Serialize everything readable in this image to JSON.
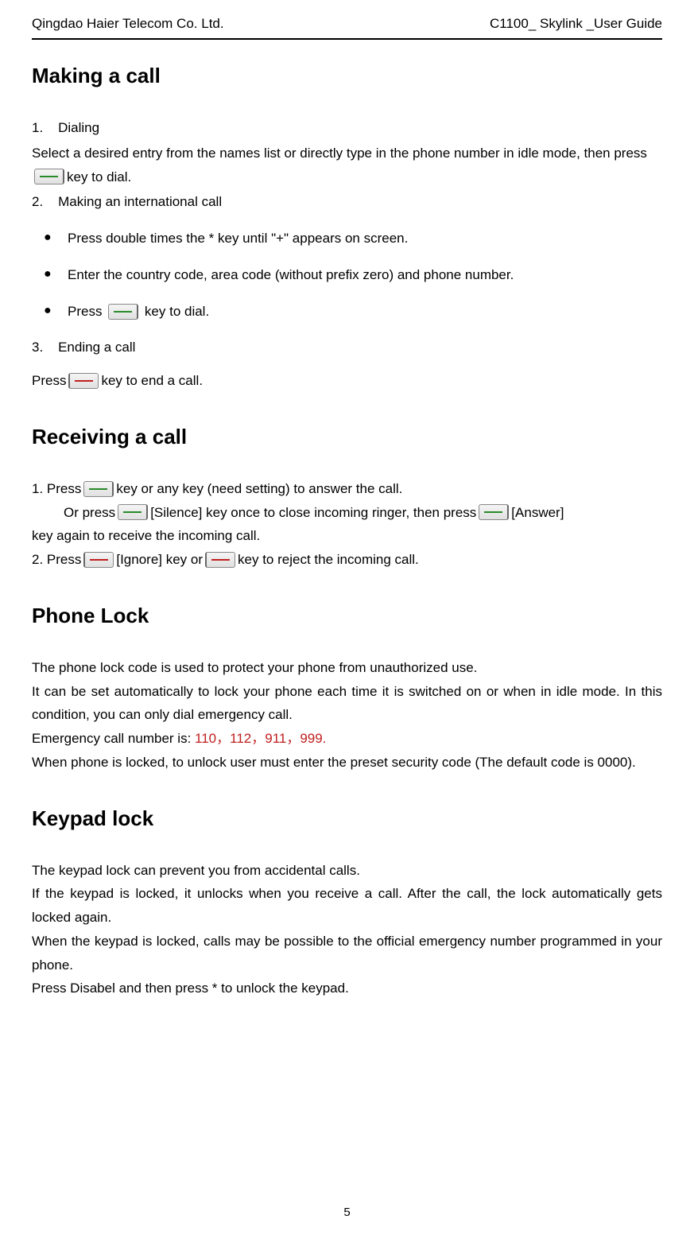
{
  "header": {
    "left": "Qingdao Haier Telecom Co. Ltd.",
    "right": "C1100_ Skylink _User Guide"
  },
  "sections": {
    "making_call": {
      "title": "Making a call",
      "item1_num": "1.",
      "item1_label": "Dialing",
      "item1_text_a": "Select a desired entry from the names list or directly type in the phone number in idle mode, then press ",
      "item1_text_b": " key to dial.",
      "item2_num": "2.",
      "item2_label": "Making an international call",
      "bullet1": "Press double times the * key until \"+\" appears on screen.",
      "bullet2": "Enter the country code, area code (without prefix zero) and phone number.",
      "bullet3_a": "Press  ",
      "bullet3_b": "  key to dial.",
      "item3_num": "3.",
      "item3_label": "Ending a call",
      "item3_text_a": "Press ",
      "item3_text_b": " key to end a call."
    },
    "receiving_call": {
      "title": "Receiving a call",
      "line1_a": "1.    Press ",
      "line1_b": " key or any key (need setting) to answer the call.",
      "line2_a": "Or press ",
      "line2_b": " [Silence] key once to close incoming ringer, then press ",
      "line2_c": " [Answer]",
      "line3": "key again to receive the incoming call.",
      "line4_a": "2.    Press ",
      "line4_b": " [Ignore] key or ",
      "line4_c": " key to reject the incoming call."
    },
    "phone_lock": {
      "title": "Phone Lock",
      "p1": "The phone lock code is used to protect your phone from unauthorized use.",
      "p2": "It can be set automatically to lock your phone each time it is switched on or when in idle mode. In this condition, you can only dial emergency call.",
      "p3_a": "Emergency call number is: ",
      "p3_b": "110，112，911，999.",
      "p4": "When phone is locked, to unlock user must enter the preset security code (The default code is 0000)."
    },
    "keypad_lock": {
      "title": "Keypad lock",
      "p1": "The keypad lock can prevent you from accidental calls.",
      "p2": "If the keypad is locked, it unlocks when you receive a call. After the call, the lock automatically gets locked again.",
      "p3": "When the keypad is locked, calls may be possible to the official emergency number programmed in your phone.",
      "p4": "Press Disabel and then press * to unlock the keypad."
    }
  },
  "page_number": "5"
}
